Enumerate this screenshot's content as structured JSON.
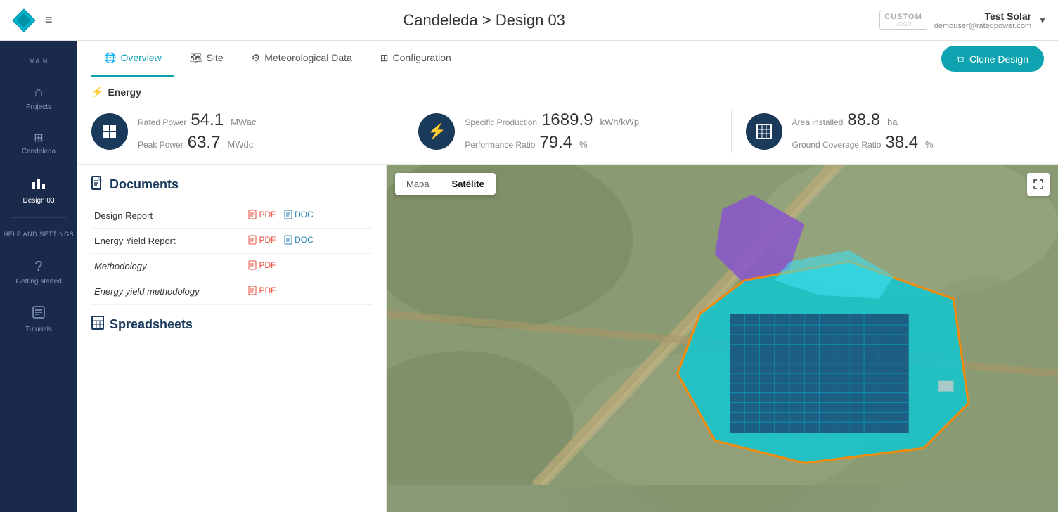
{
  "header": {
    "title": "Candeleda > Design 03",
    "custom_badge": "CUSTOM",
    "custom_sub": "LOGO",
    "user_name": "Test Solar",
    "user_email": "demouser@ratedpower.com"
  },
  "sidebar": {
    "items": [
      {
        "id": "main",
        "label": "MAIN",
        "icon": "≡"
      },
      {
        "id": "projects",
        "label": "Projects",
        "icon": "⌂"
      },
      {
        "id": "candeleda",
        "label": "Candeleda",
        "icon": "⊞"
      },
      {
        "id": "design03",
        "label": "Design 03",
        "icon": "📊",
        "active": true
      },
      {
        "id": "help",
        "label": "HELP AND SETTINGS",
        "icon": ""
      },
      {
        "id": "getting-started",
        "label": "Getting started",
        "icon": "?"
      },
      {
        "id": "tutorials",
        "label": "Tutorials",
        "icon": "📋"
      }
    ]
  },
  "tabs": [
    {
      "id": "overview",
      "label": "Overview",
      "icon": "🌐",
      "active": true
    },
    {
      "id": "site",
      "label": "Site",
      "icon": "🗺"
    },
    {
      "id": "meteorological",
      "label": "Meteorological Data",
      "icon": "⚙"
    },
    {
      "id": "configuration",
      "label": "Configuration",
      "icon": "⊞"
    }
  ],
  "clone_button": "Clone Design",
  "energy_label": "Energy",
  "stats": [
    {
      "icon": "⊞",
      "rows": [
        {
          "label": "Rated Power",
          "value": "54.1",
          "unit": "MWac"
        },
        {
          "label": "Peak Power",
          "value": "63.7",
          "unit": "MWdc"
        }
      ]
    },
    {
      "icon": "⚡",
      "rows": [
        {
          "label": "Specific Production",
          "value": "1689.9",
          "unit": "kWh/kWp"
        },
        {
          "label": "Performance Ratio",
          "value": "79.4",
          "unit": "%"
        }
      ]
    },
    {
      "icon": "🗺",
      "rows": [
        {
          "label": "Area installed",
          "value": "88.8",
          "unit": "ha"
        },
        {
          "label": "Ground Coverage Ratio",
          "value": "38.4",
          "unit": "%"
        }
      ]
    }
  ],
  "documents": {
    "title": "Documents",
    "items": [
      {
        "name": "Design Report",
        "italic": false,
        "pdf": true,
        "doc": true
      },
      {
        "name": "Energy Yield Report",
        "italic": false,
        "pdf": true,
        "doc": true
      },
      {
        "name": "Methodology",
        "italic": true,
        "pdf": true,
        "doc": false
      },
      {
        "name": "Energy yield methodology",
        "italic": true,
        "pdf": true,
        "doc": false
      }
    ],
    "pdf_label": "PDF",
    "doc_label": "DOC"
  },
  "spreadsheets": {
    "title": "Spreadsheets"
  },
  "map": {
    "mapa_btn": "Mapa",
    "satelite_btn": "Satélite",
    "satelite_active": true
  }
}
